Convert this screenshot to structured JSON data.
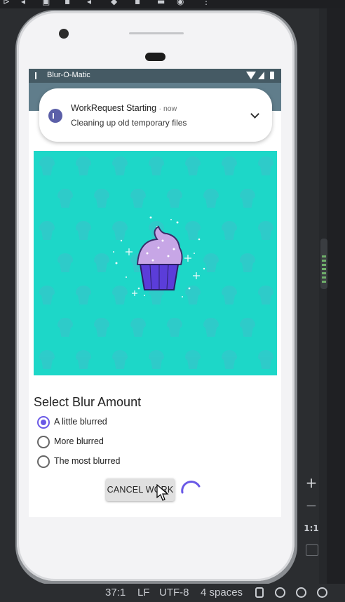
{
  "ide": {
    "statusbar": {
      "position": "37:1",
      "line_ending": "LF",
      "encoding": "UTF-8",
      "indent": "4 spaces"
    },
    "zoom_controls": {
      "zoom_in": "+",
      "zoom_out": "−",
      "actual_size": "1:1"
    }
  },
  "device": {
    "status_bar": {
      "app_name": "Blur-O-Matic"
    },
    "notification": {
      "title": "WorkRequest Starting",
      "time": "now",
      "body": "Cleaning up old temporary files"
    },
    "app": {
      "section_title": "Select Blur Amount",
      "blur_options": [
        {
          "label": "A little blurred",
          "checked": true
        },
        {
          "label": "More blurred",
          "checked": false
        },
        {
          "label": "The most blurred",
          "checked": false
        }
      ],
      "cancel_button": "CANCEL WORK"
    },
    "colors": {
      "accent": "#6a59e6",
      "image_background": "#1dd7c8",
      "app_bar": "#607d8b",
      "status_bar": "#455a64"
    }
  }
}
